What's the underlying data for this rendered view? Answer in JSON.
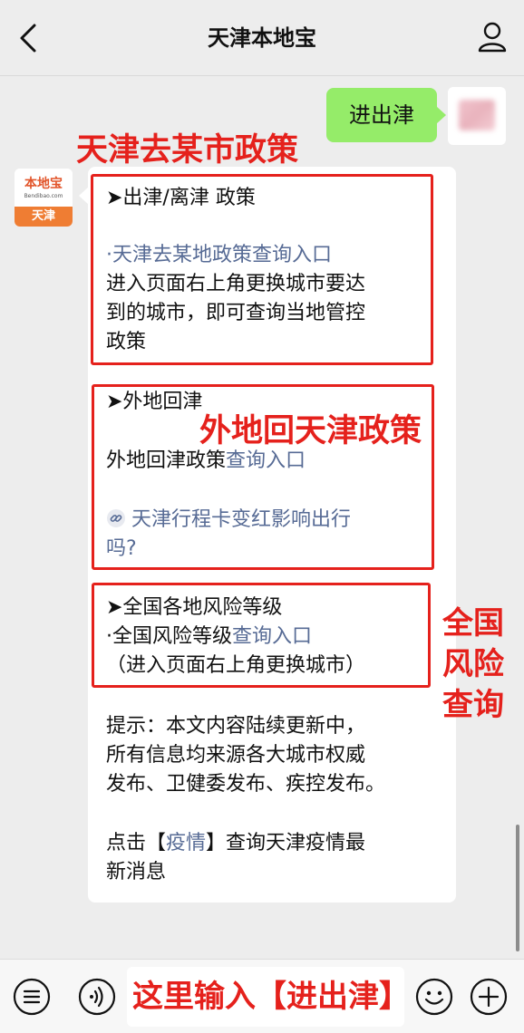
{
  "nav": {
    "title": "天津本地宝",
    "back_icon": "chevron-left-icon",
    "profile_icon": "person-icon"
  },
  "user_message": {
    "text": "进出津"
  },
  "bot_avatar": {
    "brand": "本地宝",
    "domain": "Bendibao.com",
    "city": "天津"
  },
  "message": {
    "section1": {
      "heading": "➤出津/离津 政策",
      "link": "·天津去某地政策查询入口",
      "desc_lines": [
        "进入页面右上角更换城市要达",
        "到的城市，即可查询当地管控",
        "政策"
      ]
    },
    "section2": {
      "heading": "➤外地回津",
      "line_prefix": "外地回津政策",
      "line_link": "查询入口",
      "related_lines": [
        "天津行程卡变红影响出行",
        "吗?"
      ]
    },
    "section3": {
      "heading": "➤全国各地风险等级",
      "line_prefix": "·全国风险等级",
      "line_link": "查询入口",
      "note": "（进入页面右上角更换城市）"
    },
    "tip_lines": [
      "提示：本文内容陆续更新中，",
      "所有信息均来源各大城市权威",
      "发布、卫健委发布、疾控发布。"
    ],
    "footer": {
      "prefix": "点击【",
      "keyword": "疫情",
      "suffix": "】查询天津疫情最",
      "line2": "新消息"
    }
  },
  "annotations": {
    "a1": "天津去某市政策",
    "a2": "外地回天津政策",
    "a3_lines": [
      "全国",
      "风险",
      "查询"
    ]
  },
  "input_bar": {
    "hint": "这里输入【进出津】",
    "icons": [
      "menu-list-icon",
      "voice-icon",
      "emoji-icon",
      "plus-icon"
    ]
  },
  "colors": {
    "accent_red": "#e5211c",
    "link_blue": "#576b95",
    "bubble_green": "#95ec69",
    "background": "#ededed"
  }
}
